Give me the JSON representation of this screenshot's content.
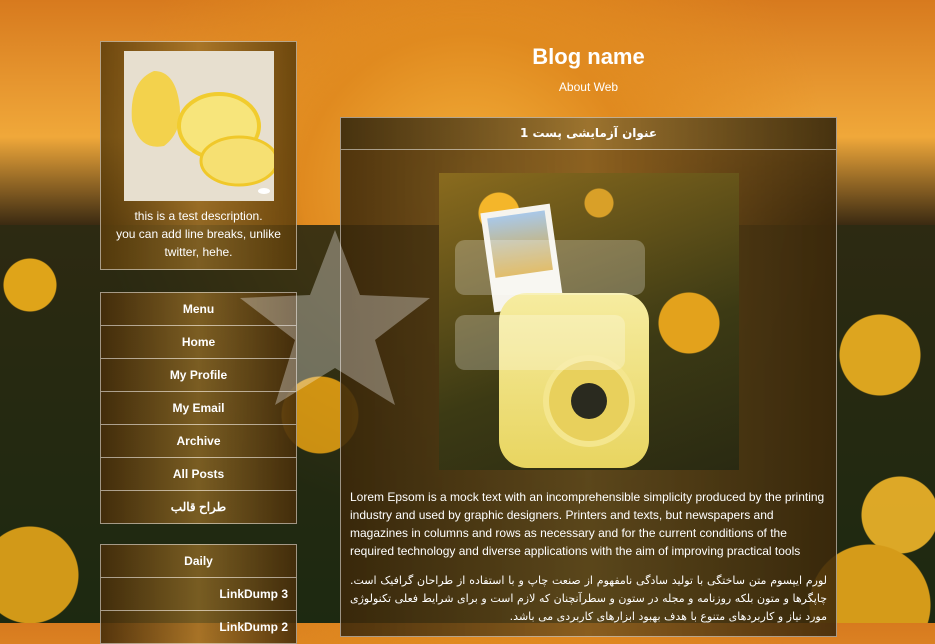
{
  "header": {
    "blog_name": "Blog name",
    "subtitle": "About Web"
  },
  "profile": {
    "description_line1": "this is a test description.",
    "description_line2": "you can add line breaks, unlike",
    "description_line3": "twitter, hehe."
  },
  "menu": {
    "items": [
      {
        "label": "Menu"
      },
      {
        "label": "Home"
      },
      {
        "label": "My Profile"
      },
      {
        "label": "My Email"
      },
      {
        "label": "Archive"
      },
      {
        "label": "All Posts"
      },
      {
        "label": "طراح قالب"
      }
    ]
  },
  "categories": {
    "items": [
      {
        "label": "Daily"
      },
      {
        "label": "LinkDump 3"
      },
      {
        "label": "LinkDump 2"
      }
    ]
  },
  "post": {
    "title": "عنوان آزمایشی پست 1",
    "body_en": "Lorem Epsom is a mock text with an incomprehensible simplicity produced by the printing industry and used by graphic designers. Printers and texts, but newspapers and magazines in columns and rows as necessary and for the current conditions of the required technology and diverse applications with the aim of improving practical tools",
    "body_fa": "لورم ایپسوم متن ساختگی با تولید سادگی نامفهوم از صنعت چاپ و با استفاده از طراحان گرافیک است. چاپگرها و متون بلکه روزنامه و مجله در ستون و سطرآنچنان که لازم است و برای شرایط فعلی تکنولوژی مورد نیاز و کاربردهای متنوع با هدف بهبود ابزارهای کاربردی می باشد."
  },
  "colors": {
    "panel_border": "#ffffff",
    "panel_bg": "#7a5518",
    "sky_orange": "#f0a83a"
  },
  "icons": {
    "watermark": "star-logo-icon"
  }
}
